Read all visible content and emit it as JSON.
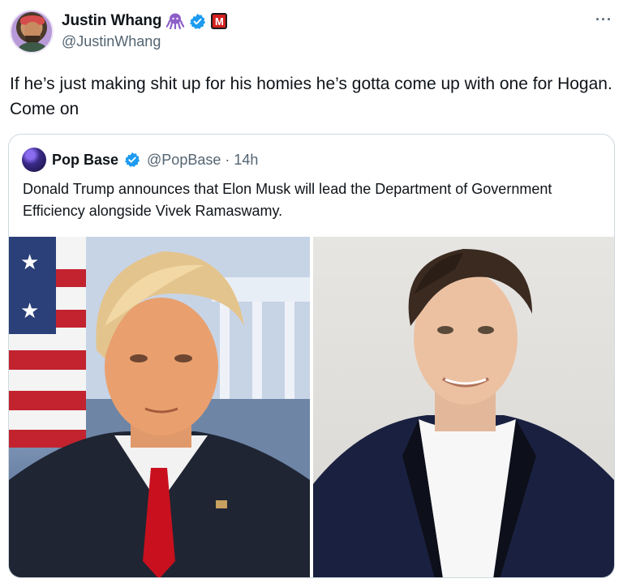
{
  "author": {
    "display_name": "Justin Whang",
    "handle": "@JustinWhang",
    "badges": [
      "octopus-icon",
      "verified-icon",
      "m-badge-icon"
    ],
    "m_badge_text": "M",
    "more_label": "···"
  },
  "tweet": {
    "text": "If he’s just making shit up for his homies he’s gotta come up with one for Hogan. Come on"
  },
  "quote": {
    "display_name": "Pop Base",
    "handle_time": "@PopBase · 14h",
    "text": "Donald Trump announces that Elon Musk will lead the Department of Government Efficiency alongside Vivek Ramaswamy.",
    "media": [
      {
        "icon": "portrait-left-photo"
      },
      {
        "icon": "portrait-right-photo"
      }
    ]
  },
  "colors": {
    "text": "#0f1419",
    "secondary": "#536471",
    "verified": "#1d9bf0",
    "border": "#cfd9de",
    "badge_red": "#d42121"
  }
}
